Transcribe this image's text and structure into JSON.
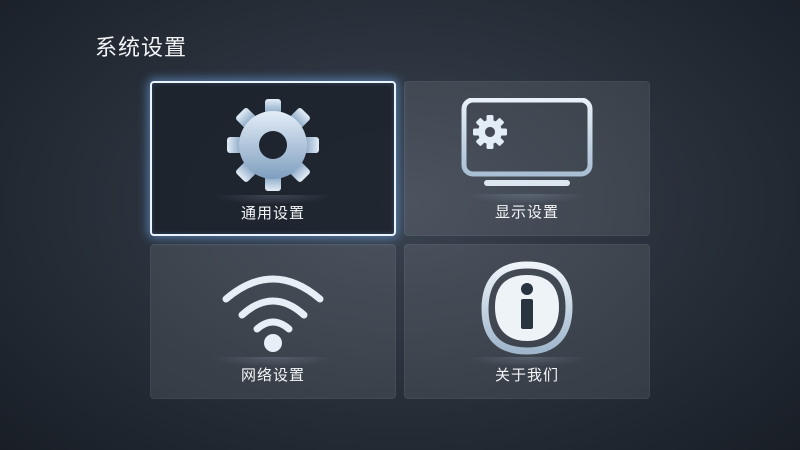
{
  "page": {
    "title": "系统设置"
  },
  "tiles": [
    {
      "label": "通用设置",
      "icon": "gear-icon",
      "focused": true
    },
    {
      "label": "显示设置",
      "icon": "monitor-icon",
      "focused": false
    },
    {
      "label": "网络设置",
      "icon": "wifi-icon",
      "focused": false
    },
    {
      "label": "关于我们",
      "icon": "info-icon",
      "focused": false
    }
  ],
  "colors": {
    "focus_border": "#eaf4ff",
    "focus_glow": "#78b4ff",
    "icon_light": "#d6e4f2",
    "icon_dark": "#7a9ab8"
  }
}
